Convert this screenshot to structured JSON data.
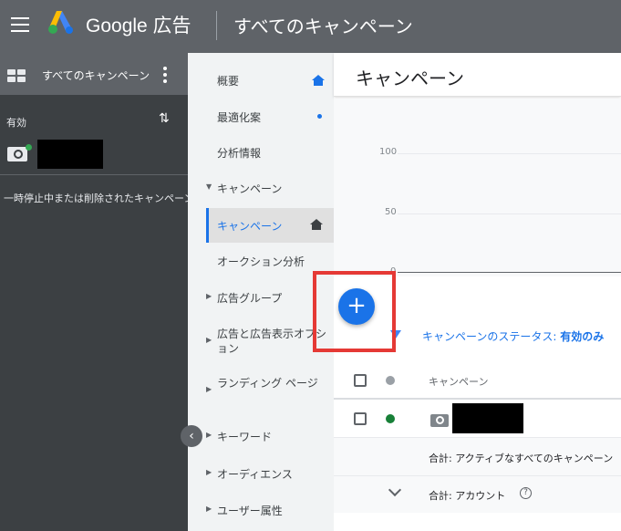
{
  "header": {
    "brand": "Google 広告",
    "title": "すべてのキャンペーン",
    "menu_icon": "hamburger-icon",
    "logo": "google-ads-logo"
  },
  "account_panel": {
    "header_label": "すべてのキャンペーン",
    "active_label": "有効",
    "paused_label": "一時停止中または削除されたキャンペーン"
  },
  "nav": {
    "items": [
      {
        "label": "概要"
      },
      {
        "label": "最適化案"
      },
      {
        "label": "分析情報"
      },
      {
        "label": "キャンペーン"
      },
      {
        "label": "キャンペーン"
      },
      {
        "label": "オークション分析"
      },
      {
        "label": "広告グループ"
      },
      {
        "label": "広告と広告表示オプション"
      },
      {
        "label": "ランディング ページ"
      },
      {
        "label": "キーワード"
      },
      {
        "label": "オーディエンス"
      },
      {
        "label": "ユーザー属性"
      }
    ]
  },
  "main": {
    "title": "キャンペーン",
    "chart": {
      "ticks": [
        "100",
        "50",
        "0"
      ]
    },
    "filter": {
      "prefix": "キャンペーンのステータス: ",
      "value": "有効のみ"
    },
    "table": {
      "col_campaign": "キャンペーン",
      "total_active": "合計: アクティブなすべてのキャンペーン",
      "total_account": "合計: アカウント"
    },
    "fab_label": "+"
  },
  "colors": {
    "header_bg": "#5f6368",
    "accent": "#1a73e8",
    "highlight": "#e53935",
    "status_green": "#188038"
  }
}
